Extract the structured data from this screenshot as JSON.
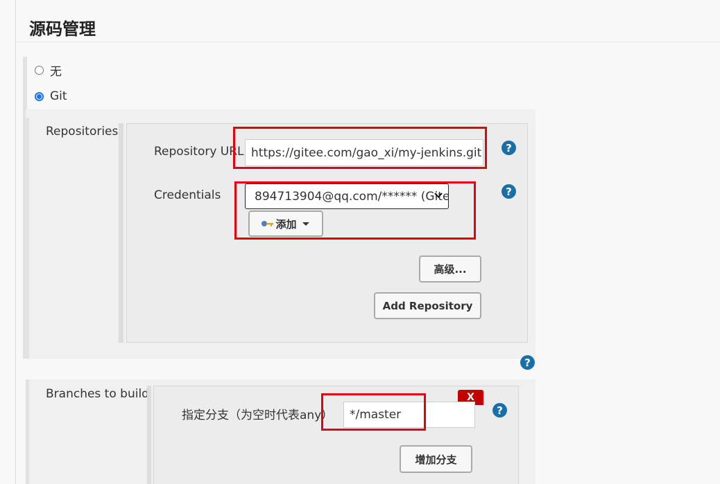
{
  "section": {
    "title": "源码管理"
  },
  "scm_options": [
    {
      "label": "无",
      "checked": false
    },
    {
      "label": "Git",
      "checked": true
    }
  ],
  "repositories": {
    "label": "Repositories",
    "url_label": "Repository URL",
    "url_value": "https://gitee.com/gao_xi/my-jenkins.git",
    "credentials_label": "Credentials",
    "credentials_value": "894713904@qq.com/****** (Gite",
    "add_label": "添加",
    "advanced_label": "高级...",
    "add_repository_label": "Add Repository"
  },
  "branches": {
    "label": "Branches to build",
    "specifier_label": "指定分支（为空时代表any）",
    "specifier_value": "*/master",
    "delete_label": "X",
    "add_branch_label": "增加分支"
  },
  "colors": {
    "highlight_box": "#e8000b",
    "help_icon": "#1a6fa9",
    "radio_checked": "#1a73e8",
    "delete_button": "#c40000"
  },
  "icons": {
    "help": "question-circle-icon",
    "credential_key": "key-icon",
    "dropdown": "caret-down-icon"
  }
}
